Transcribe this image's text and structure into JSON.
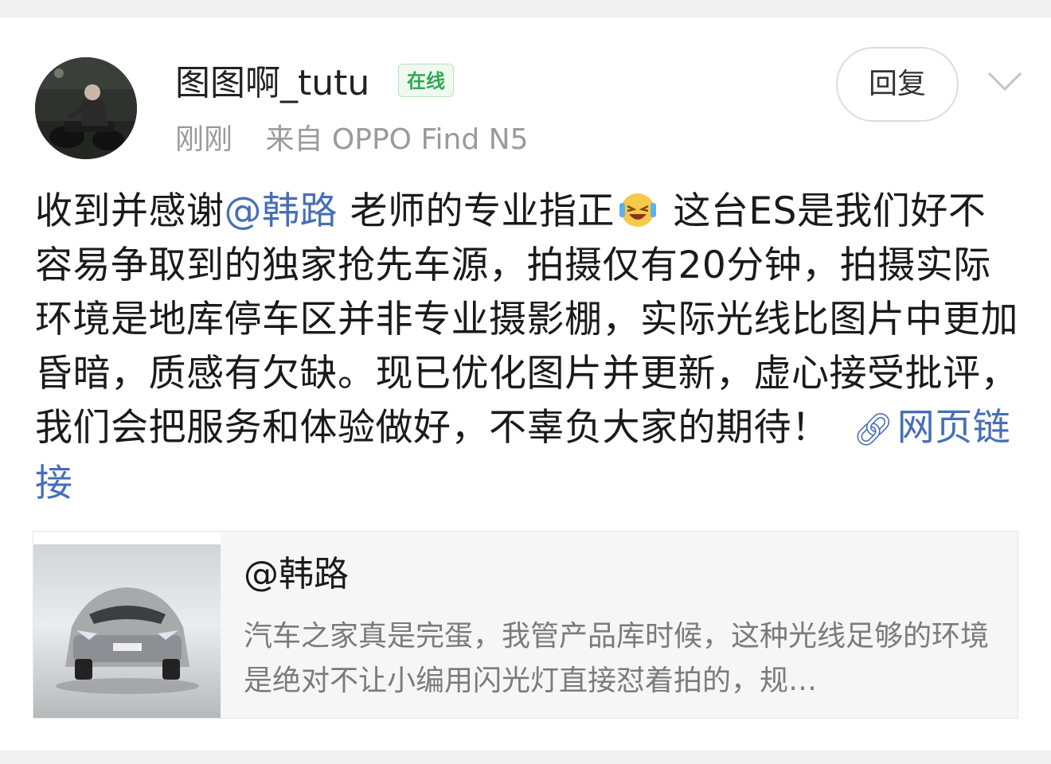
{
  "post": {
    "author": "图图啊_tutu",
    "status_badge": "在线",
    "time": "刚刚",
    "source": "来自 OPPO Find N5",
    "reply_label": "回复",
    "text_before_mention": "收到并感谢",
    "mention": "@韩路",
    "text_after_mention": " 老师的专业指正",
    "text_after_emoji": " 这台ES是我们好不容易争取到的独家抢先车源，拍摄仅有20分钟，拍摄实际环境是地库停车区并非专业摄影棚，实际光线比图片中更加昏暗，质感有欠缺。现已优化图片并更新，虚心接受批评，我们会把服务和体验做好，不辜负大家的期待！",
    "link_label": "网页链接"
  },
  "quote": {
    "author": "@韩路",
    "text": "汽车之家真是完蛋，我管产品库时候，这种光线足够的环境是绝对不让小编用闪光灯直接怼着拍的，规…"
  },
  "icons": {
    "avatar": "user-avatar-photo",
    "chevron": "chevron-down-icon",
    "emoji": "laughing-tears-emoji",
    "link": "link-icon"
  },
  "colors": {
    "mention": "#466fb5",
    "badge": "#32a852",
    "meta": "#9a9a9a"
  }
}
